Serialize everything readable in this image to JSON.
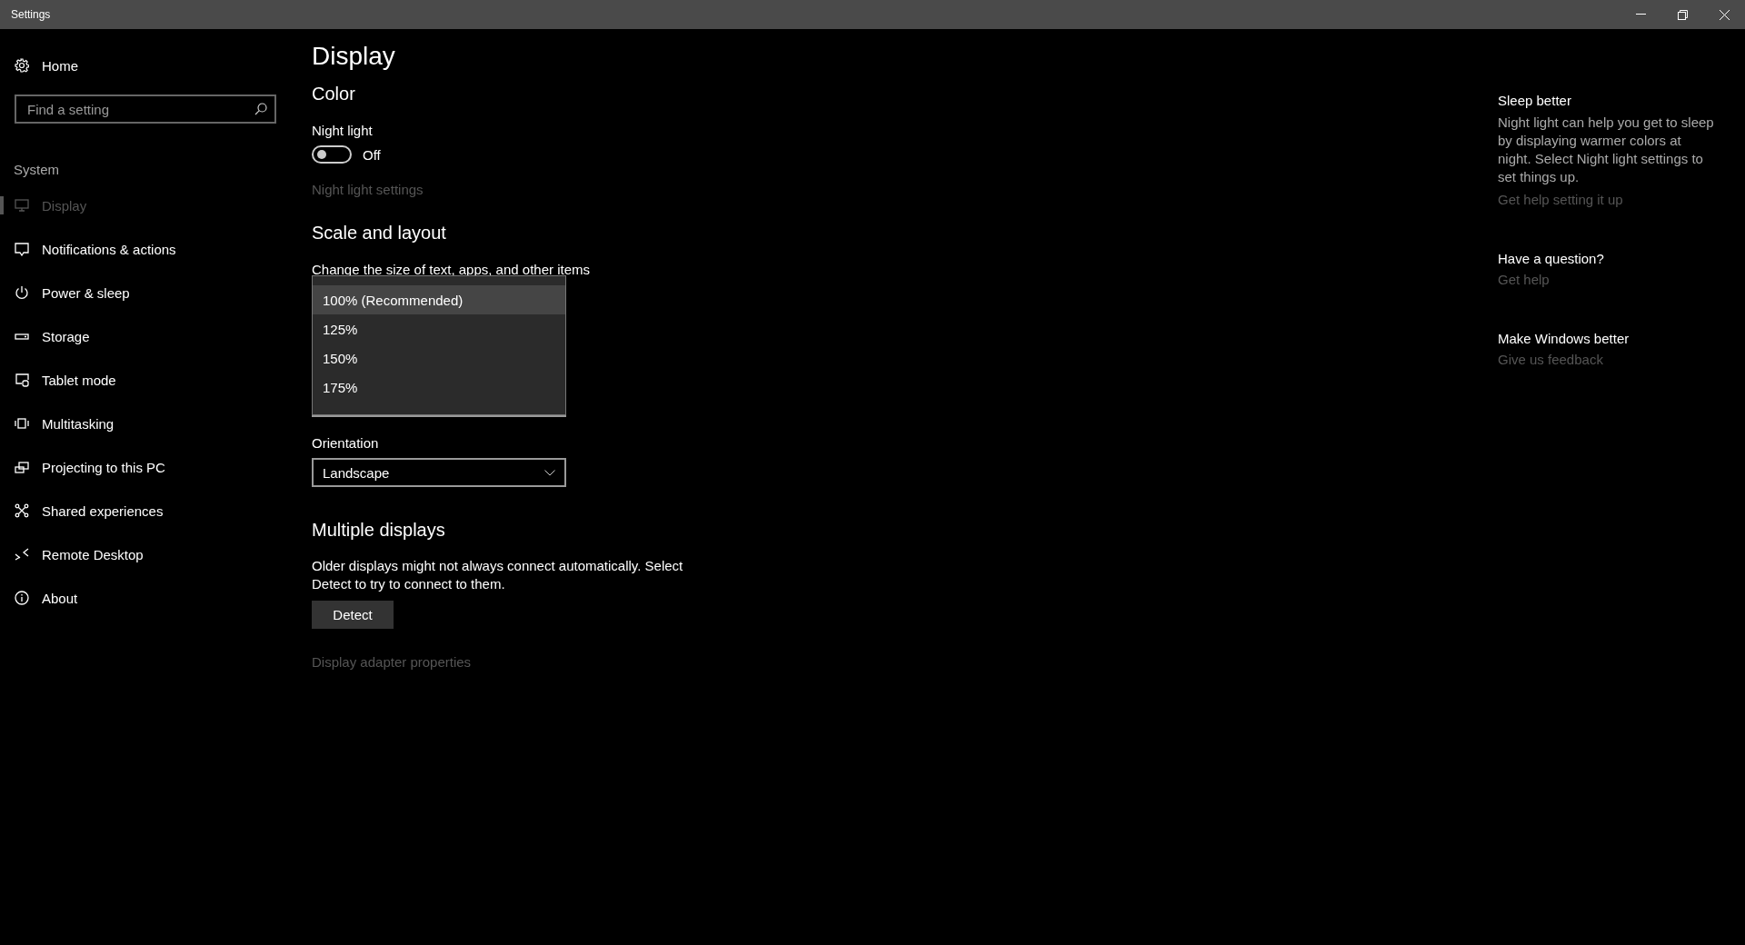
{
  "window": {
    "title": "Settings"
  },
  "sidebar": {
    "home": "Home",
    "search": {
      "placeholder": "Find a setting"
    },
    "section": "System",
    "items": [
      {
        "label": "Display",
        "selected": true
      },
      {
        "label": "Notifications & actions",
        "selected": false
      },
      {
        "label": "Power & sleep",
        "selected": false
      },
      {
        "label": "Storage",
        "selected": false
      },
      {
        "label": "Tablet mode",
        "selected": false
      },
      {
        "label": "Multitasking",
        "selected": false
      },
      {
        "label": "Projecting to this PC",
        "selected": false
      },
      {
        "label": "Shared experiences",
        "selected": false
      },
      {
        "label": "Remote Desktop",
        "selected": false
      },
      {
        "label": "About",
        "selected": false
      }
    ]
  },
  "page": {
    "title": "Display",
    "color": {
      "heading": "Color",
      "night_light": {
        "label": "Night light",
        "on": false,
        "state_text": "Off"
      },
      "link": "Night light settings"
    },
    "scale": {
      "heading": "Scale and layout",
      "label": "Change the size of text, apps, and other items",
      "dropdown": {
        "expanded": true,
        "options": [
          {
            "label": "100% (Recommended)",
            "selected": true
          },
          {
            "label": "125%",
            "selected": false
          },
          {
            "label": "150%",
            "selected": false
          },
          {
            "label": "175%",
            "selected": false
          }
        ]
      },
      "orientation": {
        "label": "Orientation",
        "value": "Landscape"
      }
    },
    "multiple": {
      "heading": "Multiple displays",
      "text": "Older displays might not always connect automatically. Select Detect to try to connect to them.",
      "button": "Detect",
      "link": "Display adapter properties"
    }
  },
  "aside": [
    {
      "heading": "Sleep better",
      "text": "Night light can help you get to sleep by displaying warmer colors at night. Select Night light settings to set things up.",
      "link": "Get help setting it up"
    },
    {
      "heading": "Have a question?",
      "link": "Get help"
    },
    {
      "heading": "Make Windows better",
      "link": "Give us feedback"
    }
  ]
}
